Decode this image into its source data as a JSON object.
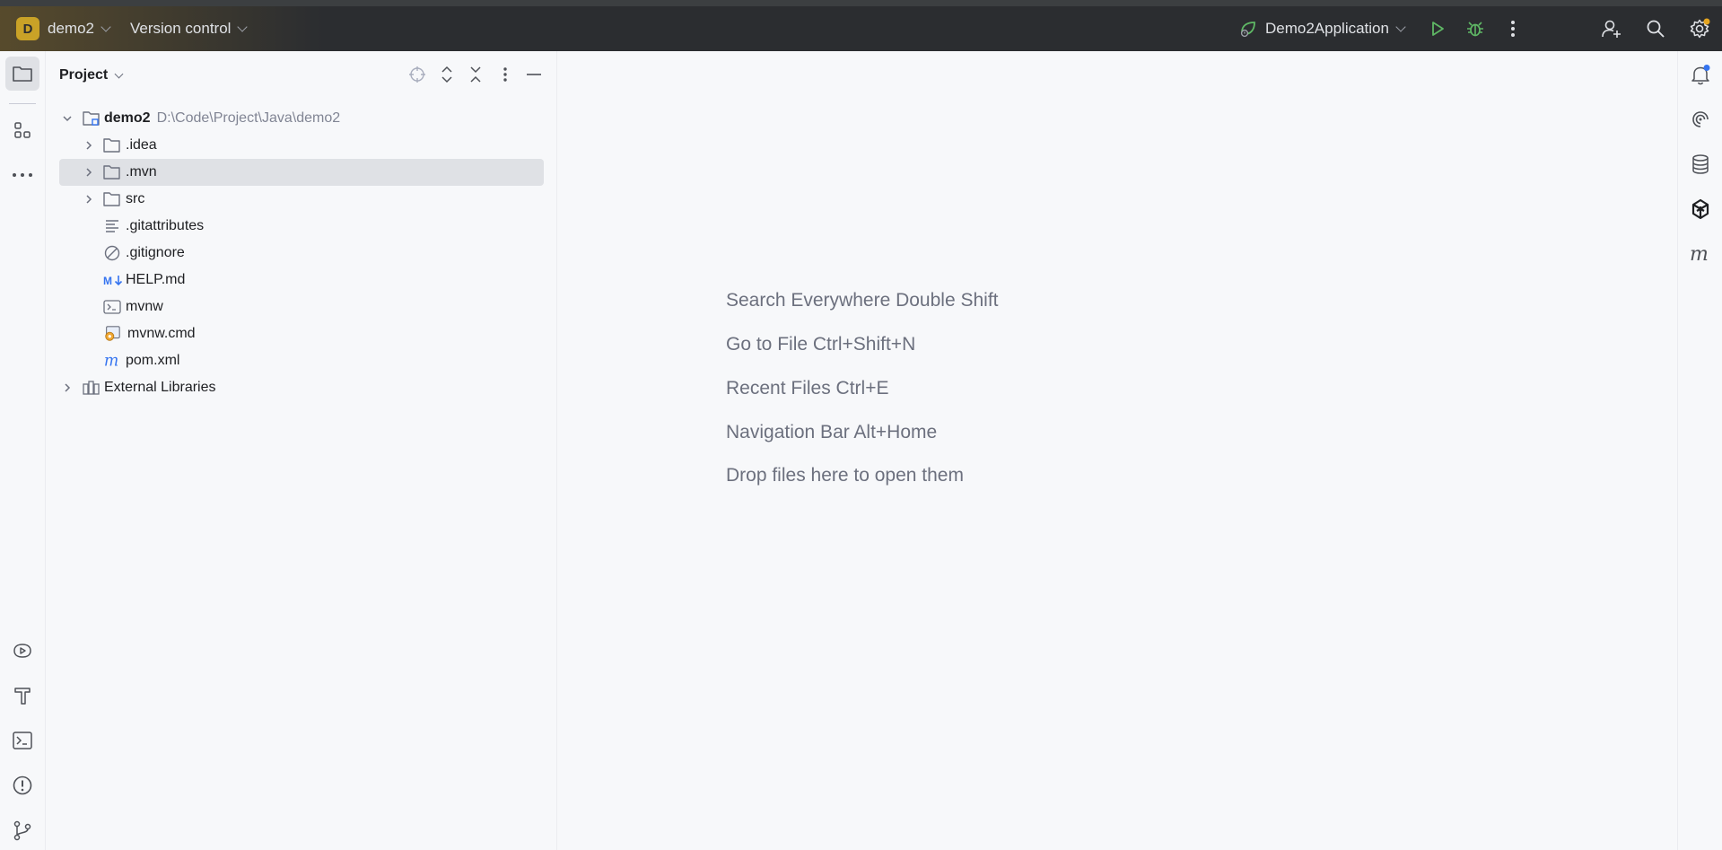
{
  "titlebar": {
    "project_initial": "D",
    "project_name": "demo2",
    "vcs_label": "Version control",
    "run_config": "Demo2Application"
  },
  "project_panel": {
    "title": "Project",
    "tree": [
      {
        "label": "demo2",
        "path": "D:\\Code\\Project\\Java\\demo2",
        "icon": "module-folder-icon",
        "expanded": true
      },
      {
        "label": ".idea",
        "icon": "folder-icon"
      },
      {
        "label": ".mvn",
        "icon": "folder-icon",
        "selected": true
      },
      {
        "label": "src",
        "icon": "folder-icon"
      },
      {
        "label": ".gitattributes",
        "icon": "text-file-icon"
      },
      {
        "label": ".gitignore",
        "icon": "ignore-file-icon"
      },
      {
        "label": "HELP.md",
        "icon": "markdown-icon"
      },
      {
        "label": "mvnw",
        "icon": "shell-script-icon"
      },
      {
        "label": "mvnw.cmd",
        "icon": "cmd-script-icon"
      },
      {
        "label": "pom.xml",
        "icon": "maven-icon"
      },
      {
        "label": "External Libraries",
        "icon": "library-icon"
      }
    ]
  },
  "editor": {
    "hints": [
      "Search Everywhere Double Shift",
      "Go to File Ctrl+Shift+N",
      "Recent Files Ctrl+E",
      "Navigation Bar Alt+Home",
      "Drop files here to open them"
    ]
  },
  "colors": {
    "titlebar_bg": "#2b2d30",
    "project_badge": "#c9a227",
    "run_green": "#5fb865",
    "selection": "#dfe1e5",
    "notification_dot": "#3574f0",
    "settings_dot": "#e5a520"
  }
}
